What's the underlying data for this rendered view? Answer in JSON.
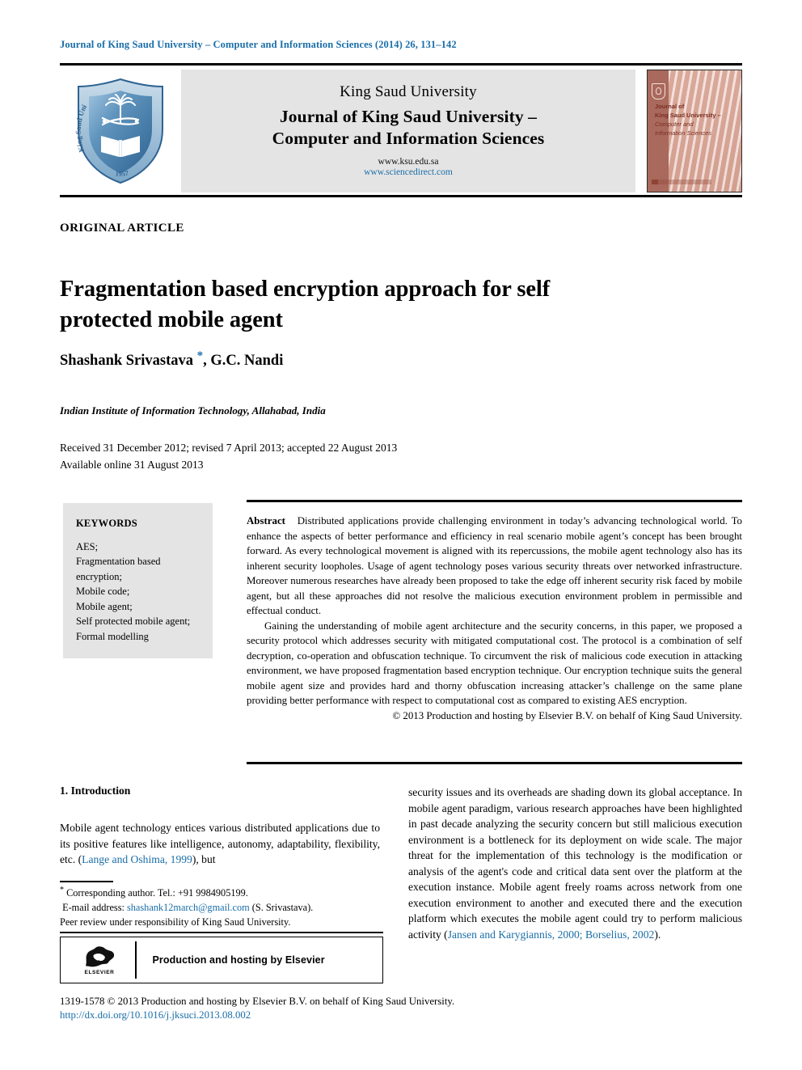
{
  "running_head": "Journal of King Saud University – Computer and Information Sciences (2014) 26, 131–142",
  "banner": {
    "university": "King Saud University",
    "journal_line1": "Journal of King Saud University –",
    "journal_line2": "Computer and Information Sciences",
    "url_ksu": "www.ksu.edu.sa",
    "url_sciencedirect": "www.sciencedirect.com",
    "logo_alt": "King Saud University shield logo",
    "logo_ring_top": "King Saud",
    "logo_ring_bottom": "University",
    "logo_year": "1957",
    "cover": {
      "line1": "Journal of",
      "line2": "King Saud University –",
      "line3": "Computer and",
      "line4": "Information Sciences"
    }
  },
  "article": {
    "type_label": "ORIGINAL ARTICLE",
    "title": "Fragmentation based encryption approach for self protected mobile agent",
    "authors_before_star": "Shashank Srivastava ",
    "corresponding_star": "*",
    "authors_after_star": ", G.C. Nandi",
    "affiliation": "Indian Institute of Information Technology, Allahabad, India",
    "dates_line1": "Received 31 December 2012; revised 7 April 2013; accepted 22 August 2013",
    "dates_line2": "Available online 31 August 2013"
  },
  "keywords": {
    "heading": "KEYWORDS",
    "items": [
      "AES;",
      "Fragmentation based encryption;",
      "Mobile code;",
      "Mobile agent;",
      "Self protected mobile agent;",
      "Formal modelling"
    ]
  },
  "abstract": {
    "label": "Abstract",
    "paragraph1": "Distributed applications provide challenging environment in today’s advancing technological world. To enhance the aspects of better performance and efficiency in real scenario mobile agent’s concept has been brought forward. As every technological movement is aligned with its repercussions, the mobile agent technology also has its inherent security loopholes. Usage of agent technology poses various security threats over networked infrastructure. Moreover numerous researches have already been proposed to take the edge off inherent security risk faced by mobile agent, but all these approaches did not resolve the malicious execution environment problem in permissible and effectual conduct.",
    "paragraph2": "Gaining the understanding of mobile agent architecture and the security concerns, in this paper, we proposed a security protocol which addresses security with mitigated computational cost. The protocol is a combination of self decryption, co-operation and obfuscation technique. To circumvent the risk of malicious code execution in attacking environment, we have proposed fragmentation based encryption technique. Our encryption technique suits the general mobile agent size and provides hard and thorny obfuscation increasing attacker’s challenge on the same plane providing better performance with respect to computational cost as compared to existing AES encryption.",
    "copyright": "© 2013 Production and hosting by Elsevier B.V. on behalf of King Saud University."
  },
  "body": {
    "section_heading": "1. Introduction",
    "left_text_a": "Mobile agent technology entices various distributed applications due to its positive features like intelligence, autonomy, adaptability, flexibility, etc. (",
    "left_ref_1": "Lange and Oshima, 1999",
    "left_text_b": "), but",
    "right_text_a": "security issues and its overheads are shading down its global acceptance. In mobile agent paradigm, various research approaches have been highlighted in past decade analyzing the security concern but still malicious execution environment is a bottleneck for its deployment on wide scale. The major threat for the implementation of this technology is the modification or analysis of the agent's code and critical data sent over the platform at the execution instance. Mobile agent freely roams across network from one execution environment to another and executed there and the execution platform which executes the mobile agent could try to perform malicious activity (",
    "right_ref_1": "Jansen and Karygiannis, 2000; Borselius, 2002",
    "right_text_b": ")."
  },
  "footnote": {
    "star": "*",
    "corresponding": " Corresponding author. Tel.: +91 9984905199.",
    "email_label": "E-mail address:",
    "email": "shashank12march@gmail.com",
    "email_suffix": " (S. Srivastava).",
    "peer_review": "Peer review under responsibility of King Saud University."
  },
  "elsevier_box": {
    "logo_word": "ELSEVIER",
    "text": "Production and hosting by Elsevier"
  },
  "footer": {
    "issn_line": "1319-1578 © 2013 Production and hosting by Elsevier B.V. on behalf of King Saud University.",
    "doi": "http://dx.doi.org/10.1016/j.jksuci.2013.08.002"
  },
  "colors": {
    "link_blue": "#1a6ea8",
    "banner_grey": "#e4e4e4",
    "cover_red": "#a9695c"
  }
}
